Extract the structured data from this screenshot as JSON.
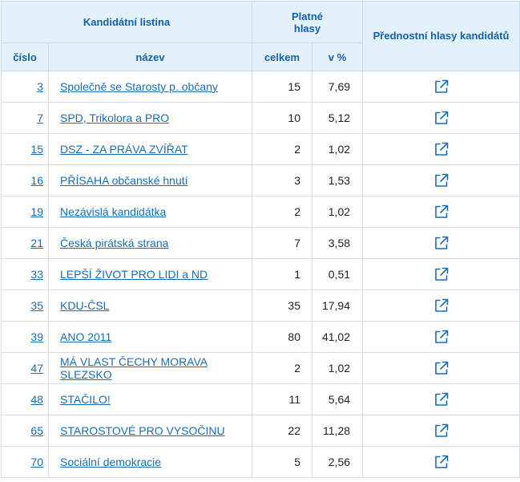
{
  "header": {
    "candidate_list": "Kandidátní listina",
    "valid_votes_line1": "Platné",
    "valid_votes_line2": "hlasy",
    "preferential_votes": "Přednostní hlasy kandidátů",
    "number": "číslo",
    "name": "název",
    "total": "celkem",
    "percent": "v %"
  },
  "colors": {
    "header_bg": "#e3f1fb",
    "header_text": "#1560a8",
    "link": "#1a6db5"
  },
  "rows": [
    {
      "number": "3",
      "name": "Společně se Starosty p. občany",
      "votes": "15",
      "percent": "7,69",
      "icon": "external-link-icon"
    },
    {
      "number": "7",
      "name": "SPD, Trikolora a PRO",
      "votes": "10",
      "percent": "5,12",
      "icon": "external-link-icon"
    },
    {
      "number": "15",
      "name": "DSZ - ZA PRÁVA ZVÍŘAT",
      "votes": "2",
      "percent": "1,02",
      "icon": "external-link-icon"
    },
    {
      "number": "16",
      "name": "PŘÍSAHA občanské hnutí",
      "votes": "3",
      "percent": "1,53",
      "icon": "external-link-icon"
    },
    {
      "number": "19",
      "name": "Nezávislá kandidátka",
      "votes": "2",
      "percent": "1,02",
      "icon": "external-link-icon"
    },
    {
      "number": "21",
      "name": "Česká pirátská strana",
      "votes": "7",
      "percent": "3,58",
      "icon": "external-link-icon"
    },
    {
      "number": "33",
      "name": "LEPŠÍ ŽIVOT PRO LIDI a ND",
      "votes": "1",
      "percent": "0,51",
      "icon": "external-link-icon"
    },
    {
      "number": "35",
      "name": "KDU-ČSL",
      "votes": "35",
      "percent": "17,94",
      "icon": "external-link-icon"
    },
    {
      "number": "39",
      "name": "ANO 2011",
      "votes": "80",
      "percent": "41,02",
      "icon": "external-link-icon"
    },
    {
      "number": "47",
      "name": "MÁ VLAST ČECHY MORAVA SLEZSKO",
      "votes": "2",
      "percent": "1,02",
      "icon": "external-link-icon"
    },
    {
      "number": "48",
      "name": "STAČILO!",
      "votes": "11",
      "percent": "5,64",
      "icon": "external-link-icon"
    },
    {
      "number": "65",
      "name": "STAROSTOVÉ PRO VYSOČINU",
      "votes": "22",
      "percent": "11,28",
      "icon": "external-link-icon"
    },
    {
      "number": "70",
      "name": "Sociální demokracie",
      "votes": "5",
      "percent": "2,56",
      "icon": "external-link-icon"
    }
  ]
}
